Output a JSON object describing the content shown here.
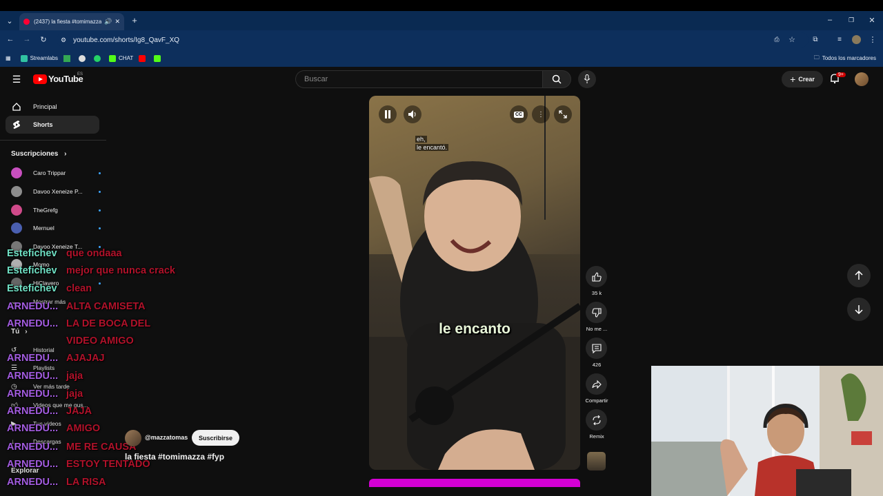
{
  "browser": {
    "tab_title": "(2437) la fiesta #tomimazza",
    "url": "youtube.com/shorts/Ig8_QavF_XQ",
    "bookmarks": [
      "Streamlabs",
      "CHAT"
    ],
    "bookmarks_folder": "Todos los marcadores"
  },
  "header": {
    "logo": "YouTube",
    "region": "ES",
    "search_placeholder": "Buscar",
    "create_label": "Crear",
    "notifications_badge": "9+"
  },
  "sidebar": {
    "items": [
      {
        "label": "Principal",
        "icon": "home-icon"
      },
      {
        "label": "Shorts",
        "icon": "shorts-icon"
      }
    ],
    "subs_heading": "Suscripciones",
    "subscriptions": [
      {
        "name": "Caro Trippar",
        "color": "#c84fbf"
      },
      {
        "name": "Davoo Xeneize P...",
        "color": "#8d8d8d"
      },
      {
        "name": "TheGrefg",
        "color": "#d04a8a"
      },
      {
        "name": "Mernuel",
        "color": "#4a5fb0"
      },
      {
        "name": "Davoo Xeneize T...",
        "color": "#777777"
      },
      {
        "name": "Momo",
        "color": "#b0b0b0"
      },
      {
        "name": "HiClavero",
        "color": "#666666"
      }
    ],
    "show_more": "Mostrar más",
    "you_heading": "Tú",
    "library": [
      "Historial",
      "Playlists",
      "Ver más tarde",
      "Videos que me gus...",
      "Tus videos",
      "Descargas"
    ],
    "explore": "Explorar"
  },
  "chat": [
    {
      "user": "Estefichev",
      "msg": "que ondaaa",
      "color": "#6fe0c4"
    },
    {
      "user": "Estefichev",
      "msg": "mejor que nunca crack",
      "color": "#6fe0c4"
    },
    {
      "user": "Estefichev",
      "msg": "clean",
      "color": "#6fe0c4"
    },
    {
      "user": "ARNEDU...",
      "msg": "ALTA CAMISETA",
      "color": "#a35ce0"
    },
    {
      "user": "ARNEDU...",
      "msg": "LA DE BOCA DEL",
      "color": "#a35ce0"
    },
    {
      "user": "",
      "msg": "VIDEO AMIGO",
      "color": "#a35ce0"
    },
    {
      "user": "ARNEDU...",
      "msg": "AJAJAJ",
      "color": "#a35ce0"
    },
    {
      "user": "ARNEDU...",
      "msg": "jaja",
      "color": "#a35ce0"
    },
    {
      "user": "ARNEDU...",
      "msg": "jaja",
      "color": "#a35ce0"
    },
    {
      "user": "ARNEDU...",
      "msg": "JAJA",
      "color": "#a35ce0"
    },
    {
      "user": "ARNEDU...",
      "msg": "AMIGO",
      "color": "#a35ce0"
    },
    {
      "user": "ARNEDU...",
      "msg": "ME RE CAUSA",
      "color": "#a35ce0"
    },
    {
      "user": "ARNEDU...",
      "msg": "ESTOY TENTADO",
      "color": "#a35ce0"
    },
    {
      "user": "ARNEDU...",
      "msg": "LA RISA",
      "color": "#a35ce0"
    }
  ],
  "video": {
    "top_caption_1": "eh,",
    "top_caption_2": "le encantó.",
    "big_caption": "le encanto",
    "progress_color": "#d400d4"
  },
  "channel": {
    "handle": "@mazzatomas",
    "subscribe_label": "Suscribirse",
    "title": "la fiesta #tomimazza #fyp"
  },
  "actions": {
    "likes": "35 k",
    "dislike_label": "No me ...",
    "comments": "426",
    "share_label": "Compartir",
    "remix_label": "Remix"
  }
}
